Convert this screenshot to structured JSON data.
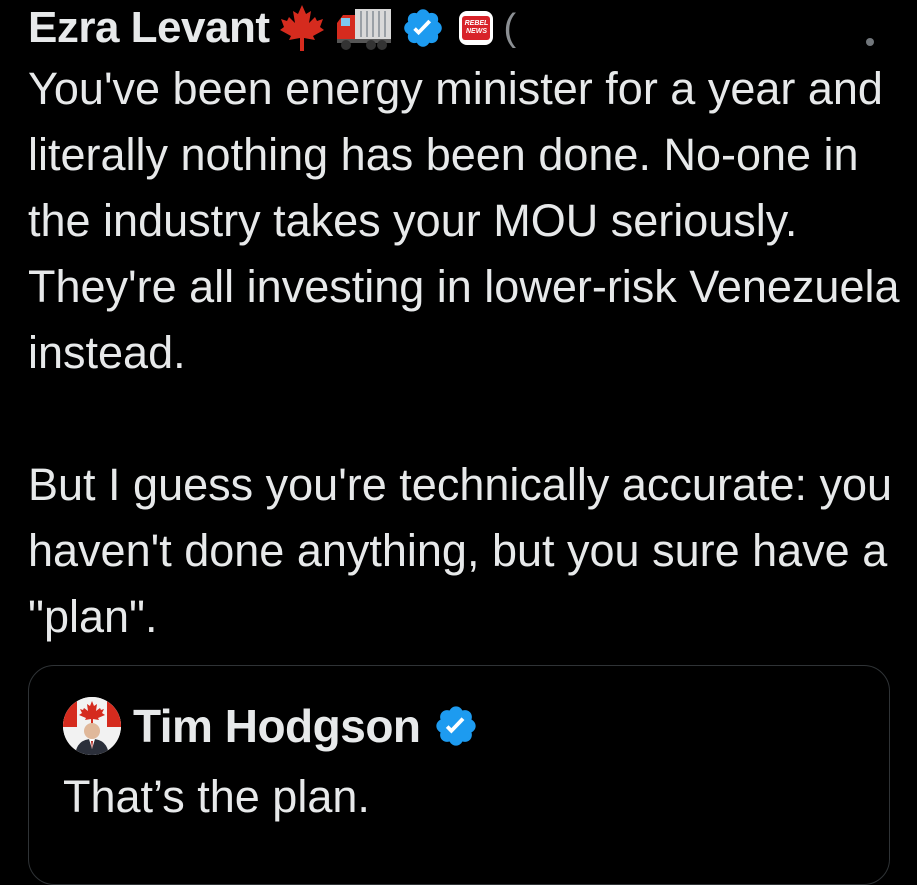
{
  "tweet": {
    "author_name": "Ezra Levant",
    "badges": [
      "maple-leaf-emoji",
      "truck-emoji",
      "verified-badge",
      "rebel-news-affiliate-badge"
    ],
    "affiliate_label": "REBEL NEWS",
    "text": "You've been energy minister for a year and literally nothing has been done. No-one in the industry takes your MOU seriously. They're all investing in lower-risk Venezuela instead.\n\nBut I guess you're technically accurate: you haven't done anything, but you sure have a \"plan\"."
  },
  "quoted_tweet": {
    "author_name": "Tim Hodgson",
    "verified": true,
    "text": "That’s the plan."
  },
  "colors": {
    "background": "#000000",
    "text": "#e7e9ea",
    "verified_blue": "#1d9bf0",
    "border": "#2f3336",
    "maple_red": "#d52b1e"
  },
  "icons": {
    "more": "more-dots-icon",
    "verified": "verified-check-icon"
  }
}
